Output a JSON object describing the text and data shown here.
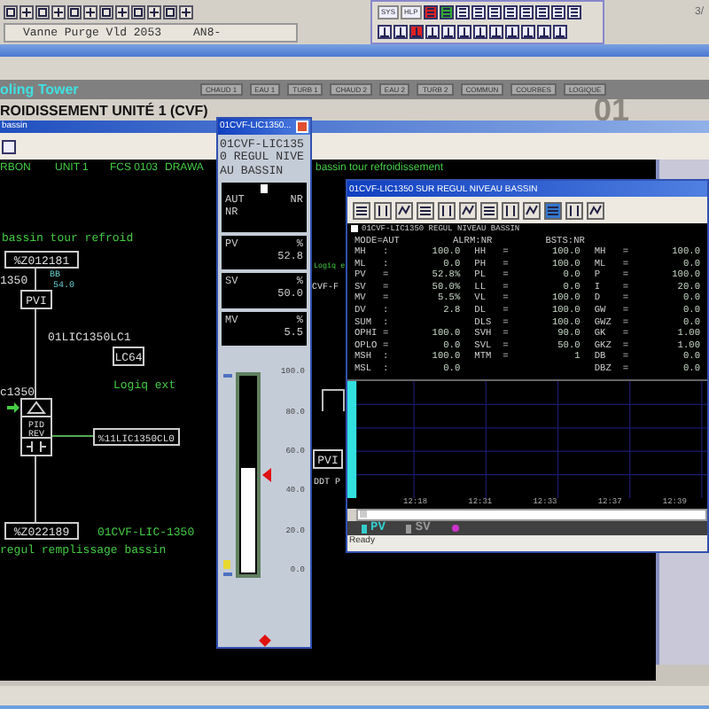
{
  "toolbar": {
    "dropdown": "Vanne Purge Vld 2053",
    "dropdown_tag": "AN8-",
    "text_buttons": [
      "SYS",
      "HLP"
    ],
    "page": "3/"
  },
  "header": {
    "title": "oling Tower",
    "buttons": [
      {
        "label": "CHAUD 1",
        "selected": false
      },
      {
        "label": "EAU 1",
        "selected": false
      },
      {
        "label": "TURB 1",
        "selected": false
      },
      {
        "label": "CHAUD 2",
        "selected": false
      },
      {
        "label": "EAU 2",
        "selected": false
      },
      {
        "label": "TURB 2",
        "selected": false
      },
      {
        "label": "COMMUN",
        "selected": false
      },
      {
        "label": "COURBES",
        "selected": false
      },
      {
        "label": "LOGIQUE",
        "selected": false
      }
    ],
    "subtitle": "ROIDISSEMENT UNITÉ 1 (CVF)",
    "unit_number": "01"
  },
  "graphic_window": {
    "title": "bassin",
    "info": [
      "RBON",
      "UNIT 1",
      "FCS 0103",
      "DRAWA"
    ],
    "caption": "bassin tour refroidissement",
    "labels": [
      "bassin tour refroid",
      "%Z012181",
      "1350",
      "BB",
      "54.0",
      "PVI",
      "01LIC1350LC1",
      "LC64",
      "Logiq ext",
      "c1350",
      "PID",
      "REV",
      "%11LIC1350CL0",
      "%Z022189",
      "01CVF-LIC-1350",
      "regul remplissage bassin",
      "Logiq e",
      "CVF-F",
      "PVI",
      "DDT P"
    ]
  },
  "faceplate": {
    "title": "01CVF-LIC1350...",
    "tag": "01CVF-LIC135 0 REGUL NIVE AU BASSIN",
    "mode": "AUT",
    "alarm": "NR",
    "status": "NR",
    "values": [
      {
        "name": "PV",
        "unit": "%",
        "value": "52.8"
      },
      {
        "name": "SV",
        "unit": "%",
        "value": "50.0"
      },
      {
        "name": "MV",
        "unit": "%",
        "value": "5.5"
      }
    ],
    "scale": [
      "100.0",
      "80.0",
      "60.0",
      "40.0",
      "20.0",
      "0.0"
    ],
    "bar": {
      "level": 0.53
    },
    "sv_marker": {
      "level": 0.5
    },
    "mv_marker": {
      "level": 0.055
    }
  },
  "trend_window": {
    "title": "01CVF-LIC1350 SUR REGUL NIVEAU BASSIN",
    "tag": "01CVF-LIC1350 REGUL NIVEAU BASSIN",
    "mode": "MODE=AUT",
    "alarm": "ALRM:NR",
    "status": "BSTS:NR",
    "columns": [
      [
        [
          "MH",
          ":",
          "100.0"
        ],
        [
          "ML",
          ":",
          "0.0"
        ],
        [
          "PV",
          "=",
          "52.8%"
        ],
        [
          "SV",
          "=",
          "50.0%"
        ],
        [
          "MV",
          "=",
          "5.5%"
        ],
        [
          "DV",
          ":",
          "2.8"
        ],
        [
          "SUM",
          ":",
          ""
        ],
        [
          "OPHI",
          "=",
          "100.0"
        ],
        [
          "OPLO",
          "=",
          "0.0"
        ],
        [
          "MSH",
          ":",
          "100.0"
        ],
        [
          "MSL",
          ":",
          "0.0"
        ]
      ],
      [
        [
          "HH",
          "=",
          "100.0"
        ],
        [
          "PH",
          "=",
          "100.0"
        ],
        [
          "PL",
          "=",
          "0.0"
        ],
        [
          "LL",
          "=",
          "0.0"
        ],
        [
          "VL",
          "=",
          "100.0"
        ],
        [
          "DL",
          "=",
          "100.0"
        ],
        [
          "DLS",
          "=",
          "100.0"
        ],
        [
          "SVH",
          "=",
          "90.0"
        ],
        [
          "SVL",
          "=",
          "50.0"
        ],
        [
          "MTM",
          "=",
          "1"
        ]
      ],
      [
        [
          "MH",
          "=",
          "100.0"
        ],
        [
          "ML",
          "=",
          "0.0"
        ],
        [
          "P",
          "=",
          "100.0"
        ],
        [
          "I",
          "=",
          "20.0"
        ],
        [
          "D",
          "=",
          "0.0"
        ],
        [
          "GW",
          "=",
          "0.0"
        ],
        [
          "GWZ",
          "=",
          "0.0"
        ],
        [
          "GK",
          "=",
          "1.00"
        ],
        [
          "GKZ",
          "=",
          "1.00"
        ],
        [
          "DB",
          "=",
          "0.0"
        ],
        [
          "DBZ",
          "=",
          "0.0"
        ]
      ]
    ],
    "times": [
      "12:18",
      "12:31",
      "12:33",
      "12:37",
      "12:39"
    ],
    "legend": [
      {
        "label": "PV",
        "color": "#33cccc"
      },
      {
        "label": "SV",
        "color": "#999999"
      },
      {
        "color": "#cc33cc"
      }
    ],
    "status_bar": "Ready"
  }
}
